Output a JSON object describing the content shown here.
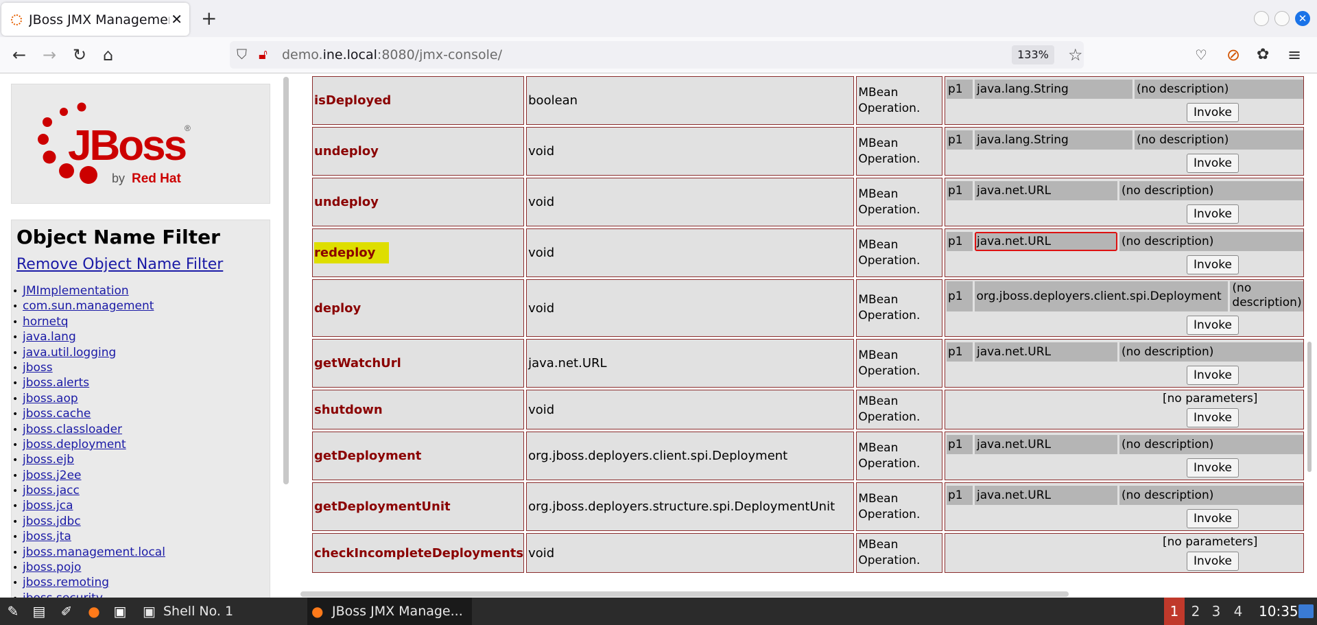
{
  "browser": {
    "tab_title": "JBoss JMX Management Console",
    "tab_close": "✕",
    "new_tab": "+",
    "url_host_prefix": "demo.",
    "url_host_domain": "ine.local",
    "url_rest": ":8080/jmx-console/",
    "zoom": "133%"
  },
  "sidebar": {
    "logo_text": "JBoss",
    "logo_registered": "®",
    "logo_by": "by",
    "logo_redhat": "Red Hat",
    "filter_title": "Object Name Filter",
    "remove_filter": "Remove Object Name Filter",
    "domains": [
      "JMImplementation",
      "com.sun.management",
      "hornetq",
      "java.lang",
      "java.util.logging",
      "jboss",
      "jboss.alerts",
      "jboss.aop",
      "jboss.cache",
      "jboss.classloader",
      "jboss.deployment",
      "jboss.ejb",
      "jboss.j2ee",
      "jboss.jacc",
      "jboss.jca",
      "jboss.jdbc",
      "jboss.jta",
      "jboss.management.local",
      "jboss.pojo",
      "jboss.remoting",
      "jboss.security"
    ]
  },
  "operations": {
    "kind_line1": "MBean",
    "kind_line2": "Operation.",
    "invoke": "Invoke",
    "no_params": "[no parameters]",
    "rows": [
      {
        "name": "isDeployed",
        "ret": "boolean",
        "p": "p1",
        "type": "java.lang.String",
        "desc": "(no description)"
      },
      {
        "name": "undeploy",
        "ret": "void",
        "p": "p1",
        "type": "java.lang.String",
        "desc": "(no description)"
      },
      {
        "name": "undeploy",
        "ret": "void",
        "p": "p1",
        "type": "java.net.URL",
        "desc": "(no description)"
      },
      {
        "name": "redeploy",
        "ret": "void",
        "p": "p1",
        "type": "java.net.URL",
        "desc": "(no description)"
      },
      {
        "name": "deploy",
        "ret": "void",
        "p": "p1",
        "type": "org.jboss.deployers.client.spi.Deployment",
        "desc": "(no description)"
      },
      {
        "name": "getWatchUrl",
        "ret": "java.net.URL",
        "p": "p1",
        "type": "java.net.URL",
        "desc": "(no description)"
      },
      {
        "name": "shutdown",
        "ret": "void"
      },
      {
        "name": "getDeployment",
        "ret": "org.jboss.deployers.client.spi.Deployment",
        "p": "p1",
        "type": "java.net.URL",
        "desc": "(no description)"
      },
      {
        "name": "getDeploymentUnit",
        "ret": "org.jboss.deployers.structure.spi.DeploymentUnit",
        "p": "p1",
        "type": "java.net.URL",
        "desc": "(no description)"
      },
      {
        "name": "checkIncompleteDeployments",
        "ret": "void"
      }
    ]
  },
  "taskbar": {
    "task_shell": "Shell No. 1",
    "task_browser": "JBoss JMX Manage...",
    "workspaces": [
      "1",
      "2",
      "3",
      "4"
    ],
    "clock": "10:35"
  },
  "colors": {
    "operation_name": "#8a0000",
    "highlight": "#dede00",
    "jboss_red": "#cc0000",
    "link": "#1a1aa6"
  }
}
